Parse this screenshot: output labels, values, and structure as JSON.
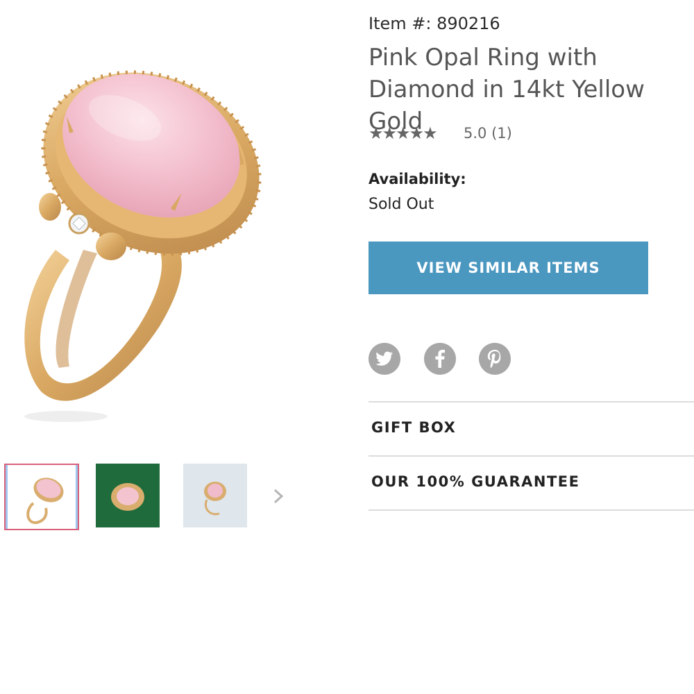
{
  "product": {
    "item_number": "Item #: 890216",
    "title": "Pink Opal Ring with Diamond in 14kt Yellow Gold",
    "stars": "★★★★★",
    "rating_text": "5.0  (1)",
    "availability_label": "Availability:",
    "availability_value": "Sold Out",
    "cta_label": "VIEW SIMILAR ITEMS"
  },
  "gallery": {
    "thumbnail_count": 3,
    "selected_index": 0
  },
  "social": [
    "twitter-icon",
    "facebook-icon",
    "pinterest-icon"
  ],
  "accordion": {
    "gift_box": "GIFT BOX",
    "guarantee": "OUR 100% GUARANTEE"
  },
  "colors": {
    "cta": "#4a97c0",
    "gold": "#d9ad6e",
    "opal": "#f3c3cf",
    "social_bg": "#a7a7a7"
  }
}
